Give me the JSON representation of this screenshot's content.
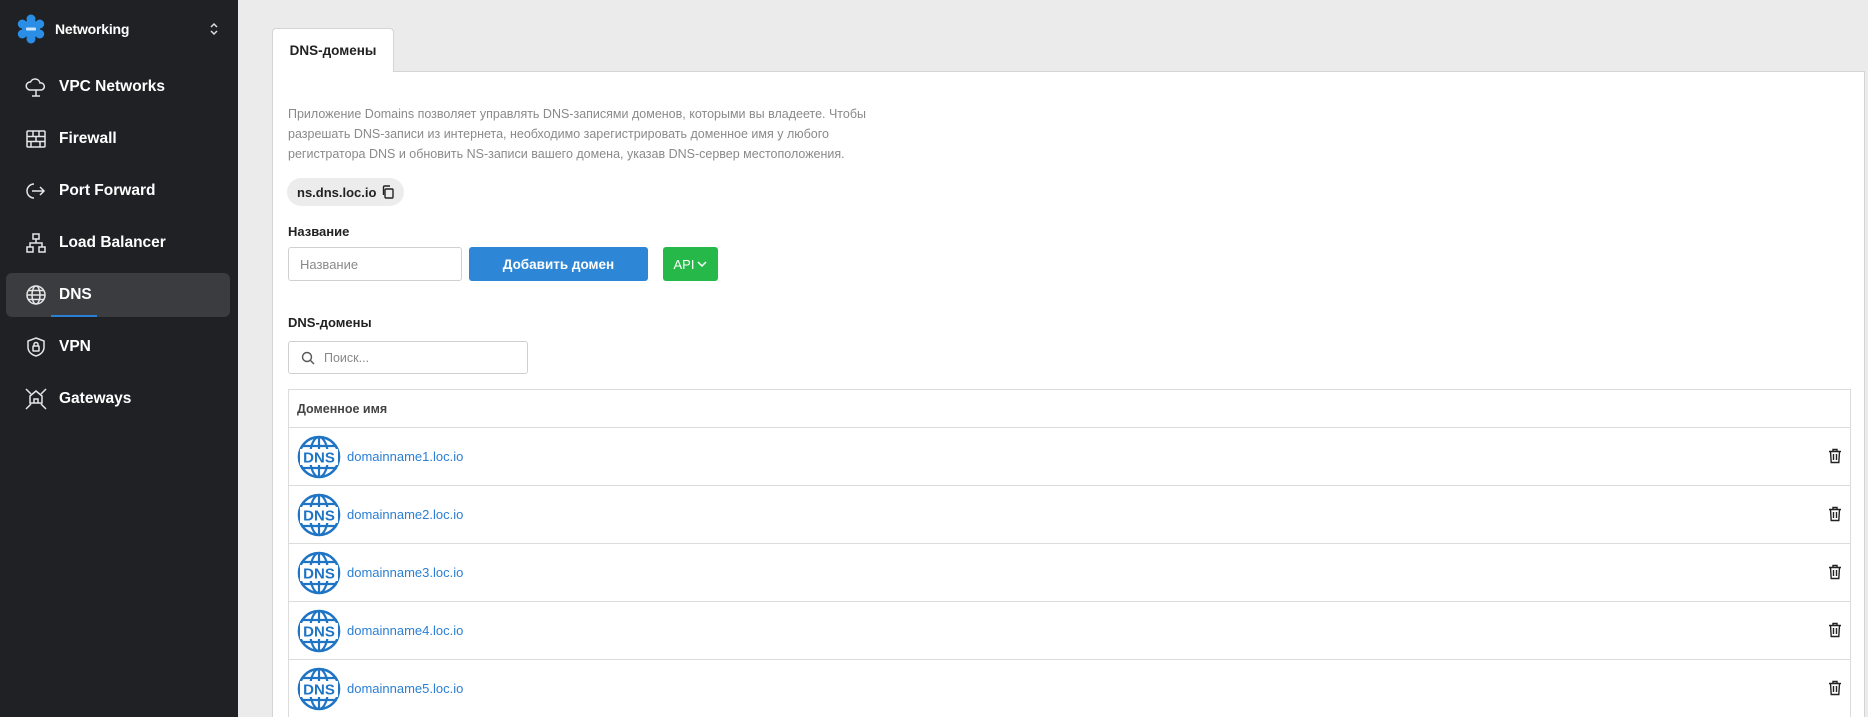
{
  "sidebar": {
    "app_title": "Networking",
    "items": [
      {
        "label": "VPC Networks",
        "icon": "cloud-network-icon",
        "active": false
      },
      {
        "label": "Firewall",
        "icon": "firewall-brick-icon",
        "active": false
      },
      {
        "label": "Port Forward",
        "icon": "port-forward-icon",
        "active": false
      },
      {
        "label": "Load Balancer",
        "icon": "load-balancer-icon",
        "active": false
      },
      {
        "label": "DNS",
        "icon": "globe-icon",
        "active": true
      },
      {
        "label": "VPN",
        "icon": "shield-lock-icon",
        "active": false
      },
      {
        "label": "Gateways",
        "icon": "gateway-icon",
        "active": false
      }
    ]
  },
  "main": {
    "tab_label": "DNS-домены",
    "description": "Приложение Domains позволяет управлять DNS-записями доменов, которыми вы владеете. Чтобы разрешать DNS-записи из интернета, необходимо зарегистрировать доменное имя у любого регистратора DNS и обновить NS-записи вашего домена, указав DNS-сервер местоположения.",
    "ns_server": "ns.dns.loc.io",
    "name_label": "Название",
    "name_placeholder": "Название",
    "add_button": "Добавить домен",
    "api_button": "API",
    "domains_label": "DNS-домены",
    "search_placeholder": "Поиск...",
    "table": {
      "column_header": "Доменное имя",
      "badge_text": "DNS",
      "rows": [
        {
          "domain": "domainname1.loc.io"
        },
        {
          "domain": "domainname2.loc.io"
        },
        {
          "domain": "domainname3.loc.io"
        },
        {
          "domain": "domainname4.loc.io"
        },
        {
          "domain": "domainname5.loc.io"
        }
      ]
    }
  },
  "colors": {
    "sidebar_bg": "#1f2124",
    "active_item_bg": "#3a3c40",
    "accent_blue": "#2d87d6",
    "link_blue": "#2a7fd4",
    "api_green": "#27b84a"
  }
}
